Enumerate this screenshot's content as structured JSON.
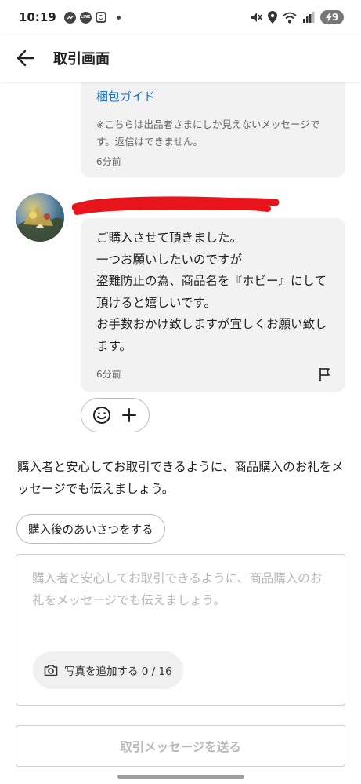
{
  "status_bar": {
    "time": "10:19",
    "battery": "9",
    "icons": [
      "messenger-icon",
      "line-icon",
      "instagram-icon",
      "notification-dot",
      "mute-icon",
      "location-icon",
      "wifi-icon",
      "signal-icon",
      "battery-charging-icon"
    ]
  },
  "header": {
    "title": "取引画面",
    "back_icon": "arrow-left-icon"
  },
  "system_message": {
    "link": "梱包ガイド",
    "note": "※こちらは出品者さまにしか見えないメッセージです。返信はできません。",
    "time": "6分前"
  },
  "buyer_message": {
    "username_redacted": true,
    "text": "ご購入させて頂きました。\n一つお願いしたいのですが\n盗難防止の為、商品名を『ホビー』にして頂けると嬉しいです。\nお手数おかけ致しますが宜しくお願い致します。",
    "time": "6分前",
    "flag_icon": "flag-icon"
  },
  "reactions": {
    "emoji_icon": "smiley-icon",
    "add_icon": "plus-icon"
  },
  "guidance": {
    "text": "購入者と安心してお取引できるように、商品購入のお礼をメッセージでも伝えましょう。"
  },
  "greeting_button": {
    "label": "購入後のあいさつをする"
  },
  "compose": {
    "placeholder": "購入者と安心してお取引できるように、商品購入のお礼をメッセージでも伝えましょう。",
    "value": "",
    "add_photo_label": "写真を追加する 0 / 16",
    "camera_icon": "camera-icon"
  },
  "send_button": {
    "label": "取引メッセージを送る"
  },
  "colors": {
    "link": "#1a73c8",
    "bubble": "#f2f2f2",
    "redaction": "#e8141c",
    "disabled_text": "#b8b8b8"
  }
}
